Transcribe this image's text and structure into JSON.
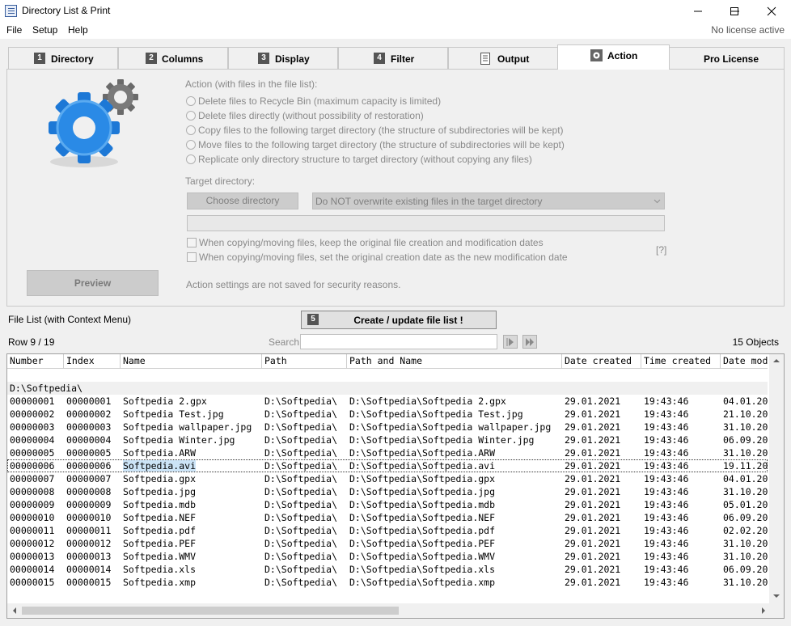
{
  "window": {
    "title": "Directory List & Print"
  },
  "menu": {
    "items": [
      "File",
      "Setup",
      "Help"
    ],
    "license_status": "No license active"
  },
  "tabs": [
    {
      "num": "1",
      "label": "Directory"
    },
    {
      "num": "2",
      "label": "Columns"
    },
    {
      "num": "3",
      "label": "Display"
    },
    {
      "num": "4",
      "label": "Filter"
    },
    {
      "num": "",
      "label": "Output"
    },
    {
      "num": "",
      "label": "Action"
    },
    {
      "num": "",
      "label": "Pro License"
    }
  ],
  "action_panel": {
    "heading": "Action (with files in the file list):",
    "options": [
      "Delete files to Recycle Bin (maximum capacity is limited)",
      "Delete files directly (without possibility of restoration)",
      "Copy files to the following target directory (the structure of subdirectories will be kept)",
      "Move files to the following target directory (the structure of subdirectories will be kept)",
      "Replicate only directory structure to target directory (without copying any files)"
    ],
    "target_label": "Target directory:",
    "choose_button": "Choose directory",
    "overwrite_option": "Do NOT overwrite existing files in the target directory",
    "check_keep_dates": "When copying/moving files, keep the original file creation and modification dates",
    "check_set_date": "When copying/moving files, set the original creation date as the new modification date",
    "help_link": "[?]",
    "note": "Action settings are not saved for security reasons.",
    "preview_button": "Preview"
  },
  "file_list": {
    "label": "File List (with Context Menu)",
    "create_button": {
      "num": "5",
      "label": "Create / update file list !"
    },
    "row_info": "Row 9 / 19",
    "search_label": "Search",
    "objects_count": "15 Objects",
    "columns": [
      "Number",
      "Index",
      "Name",
      "Path",
      "Path and Name",
      "Date created",
      "Time created",
      "Date mod"
    ],
    "group": "D:\\Softpedia\\",
    "rows": [
      [
        "00000001",
        "00000001",
        "Softpedia 2.gpx",
        "D:\\Softpedia\\",
        "D:\\Softpedia\\Softpedia 2.gpx",
        "29.01.2021",
        "19:43:46",
        "04.01.20"
      ],
      [
        "00000002",
        "00000002",
        "Softpedia Test.jpg",
        "D:\\Softpedia\\",
        "D:\\Softpedia\\Softpedia Test.jpg",
        "29.01.2021",
        "19:43:46",
        "21.10.20"
      ],
      [
        "00000003",
        "00000003",
        "Softpedia wallpaper.jpg",
        "D:\\Softpedia\\",
        "D:\\Softpedia\\Softpedia wallpaper.jpg",
        "29.01.2021",
        "19:43:46",
        "31.10.20"
      ],
      [
        "00000004",
        "00000004",
        "Softpedia Winter.jpg",
        "D:\\Softpedia\\",
        "D:\\Softpedia\\Softpedia Winter.jpg",
        "29.01.2021",
        "19:43:46",
        "06.09.20"
      ],
      [
        "00000005",
        "00000005",
        "Softpedia.ARW",
        "D:\\Softpedia\\",
        "D:\\Softpedia\\Softpedia.ARW",
        "29.01.2021",
        "19:43:46",
        "31.10.20"
      ],
      [
        "00000006",
        "00000006",
        "Softpedia.avi",
        "D:\\Softpedia\\",
        "D:\\Softpedia\\Softpedia.avi",
        "29.01.2021",
        "19:43:46",
        "19.11.20"
      ],
      [
        "00000007",
        "00000007",
        "Softpedia.gpx",
        "D:\\Softpedia\\",
        "D:\\Softpedia\\Softpedia.gpx",
        "29.01.2021",
        "19:43:46",
        "04.01.20"
      ],
      [
        "00000008",
        "00000008",
        "Softpedia.jpg",
        "D:\\Softpedia\\",
        "D:\\Softpedia\\Softpedia.jpg",
        "29.01.2021",
        "19:43:46",
        "31.10.20"
      ],
      [
        "00000009",
        "00000009",
        "Softpedia.mdb",
        "D:\\Softpedia\\",
        "D:\\Softpedia\\Softpedia.mdb",
        "29.01.2021",
        "19:43:46",
        "05.01.20"
      ],
      [
        "00000010",
        "00000010",
        "Softpedia.NEF",
        "D:\\Softpedia\\",
        "D:\\Softpedia\\Softpedia.NEF",
        "29.01.2021",
        "19:43:46",
        "06.09.20"
      ],
      [
        "00000011",
        "00000011",
        "Softpedia.pdf",
        "D:\\Softpedia\\",
        "D:\\Softpedia\\Softpedia.pdf",
        "29.01.2021",
        "19:43:46",
        "02.02.20"
      ],
      [
        "00000012",
        "00000012",
        "Softpedia.PEF",
        "D:\\Softpedia\\",
        "D:\\Softpedia\\Softpedia.PEF",
        "29.01.2021",
        "19:43:46",
        "31.10.20"
      ],
      [
        "00000013",
        "00000013",
        "Softpedia.WMV",
        "D:\\Softpedia\\",
        "D:\\Softpedia\\Softpedia.WMV",
        "29.01.2021",
        "19:43:46",
        "31.10.20"
      ],
      [
        "00000014",
        "00000014",
        "Softpedia.xls",
        "D:\\Softpedia\\",
        "D:\\Softpedia\\Softpedia.xls",
        "29.01.2021",
        "19:43:46",
        "06.09.20"
      ],
      [
        "00000015",
        "00000015",
        "Softpedia.xmp",
        "D:\\Softpedia\\",
        "D:\\Softpedia\\Softpedia.xmp",
        "29.01.2021",
        "19:43:46",
        "31.10.20"
      ]
    ],
    "selected_row": 6
  }
}
